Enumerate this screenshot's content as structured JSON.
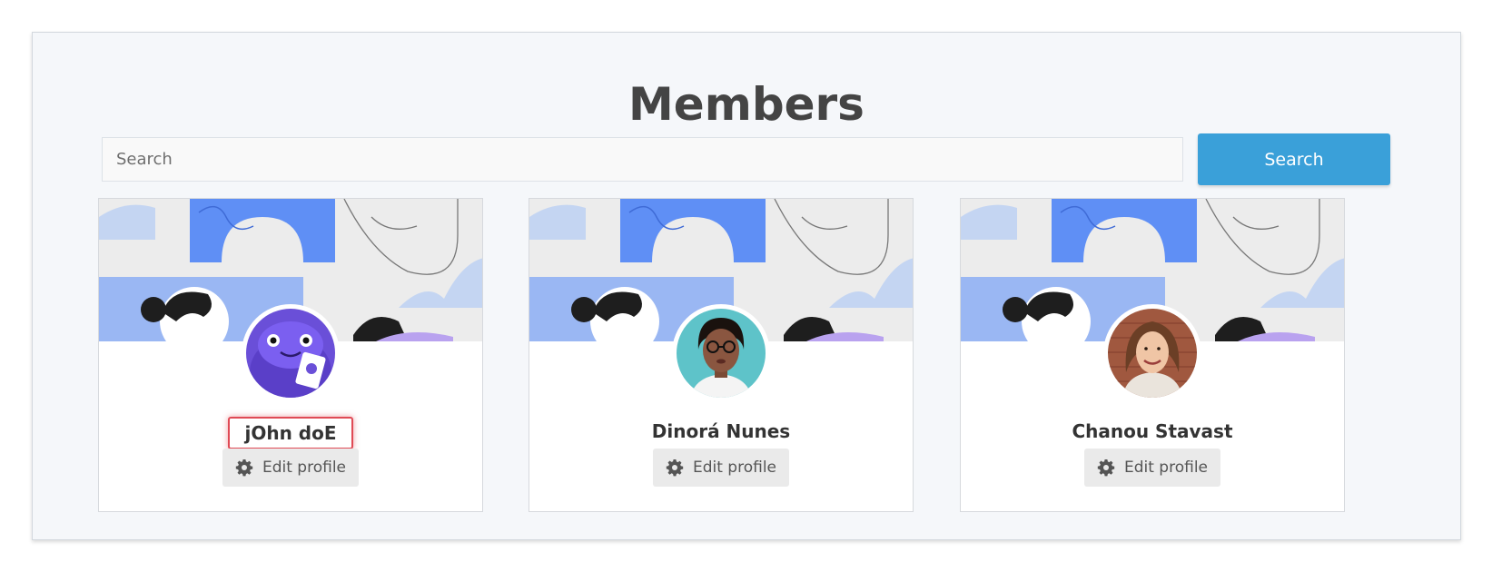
{
  "page": {
    "title": "Members"
  },
  "search": {
    "placeholder": "Search",
    "value": "",
    "button_label": "Search"
  },
  "members": [
    {
      "name": "jOhn doE",
      "edit_label": "Edit profile",
      "avatar_icon": "monster-avatar",
      "highlighted": true
    },
    {
      "name": "Dinorá Nunes",
      "edit_label": "Edit profile",
      "avatar_icon": "woman-glasses-avatar",
      "highlighted": false
    },
    {
      "name": "Chanou Stavast",
      "edit_label": "Edit profile",
      "avatar_icon": "woman-smiling-avatar",
      "highlighted": false
    }
  ],
  "colors": {
    "accent": "#3aa0d9",
    "panel_bg": "#f5f7fa",
    "cover_blue": "#5f8ff5",
    "cover_light_blue": "#c4d5f2",
    "highlight": "#e04a55"
  }
}
